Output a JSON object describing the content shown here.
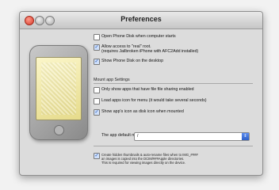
{
  "window": {
    "title": "Preferences"
  },
  "options": [
    {
      "label": "Open Phone Disk when computer starts",
      "checked": false
    },
    {
      "label": "Allow access to \"real\" root.",
      "sub": "(requires Jailbroken iPhone with AFC2Add installed)",
      "checked": true
    },
    {
      "label": "Show Phone Disk on the desktop",
      "checked": true
    }
  ],
  "mount": {
    "section_title": "Mount app Settings",
    "options": [
      {
        "label": "Only show apps that have file file sharing enabled",
        "checked": false
      },
      {
        "label": "Load apps icon for menu (it would take several seconds)",
        "checked": false
      },
      {
        "label": "Show app's icon as disk icon when mounted",
        "checked": true
      }
    ],
    "path_label": "The app default mount path:",
    "path_value": "/"
  },
  "note": {
    "checked": true,
    "lines": [
      "Create hidden thumbnails & auto-rename files when to IMG_####",
      "an images is copied into the DCIM/###Apple directories.",
      "This is required for viewing images directly on the device."
    ]
  },
  "icons": {
    "device": "iphone-device-icon",
    "dropdown": "updown-arrow-icon"
  }
}
